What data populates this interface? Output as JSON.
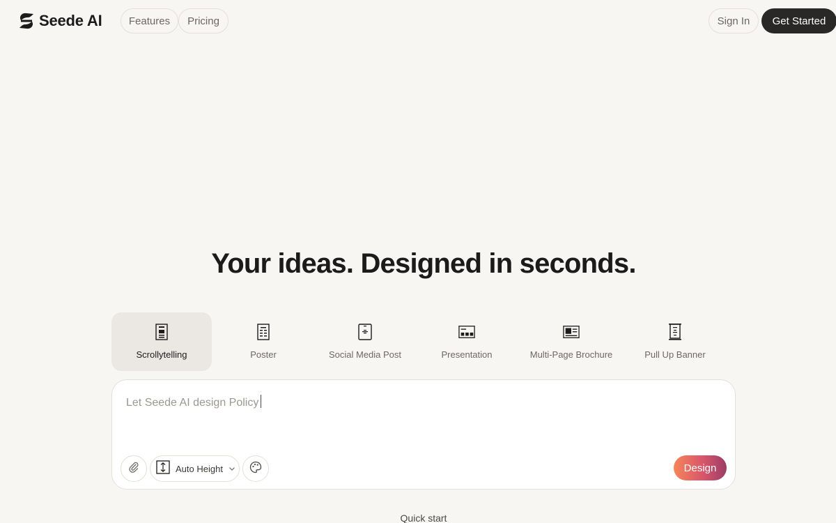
{
  "brand": {
    "name": "Seede AI",
    "icon": "seede-logo-icon"
  },
  "nav": {
    "features": "Features",
    "pricing": "Pricing",
    "sign_in": "Sign In",
    "get_started": "Get Started"
  },
  "hero": {
    "title": "Your ideas. Designed in seconds."
  },
  "types": [
    {
      "label": "Scrollytelling",
      "icon": "scrollytelling-icon",
      "active": true
    },
    {
      "label": "Poster",
      "icon": "poster-icon",
      "active": false
    },
    {
      "label": "Social Media Post",
      "icon": "social-post-icon",
      "active": false
    },
    {
      "label": "Presentation",
      "icon": "presentation-icon",
      "active": false
    },
    {
      "label": "Multi-Page Brochure",
      "icon": "brochure-icon",
      "active": false
    },
    {
      "label": "Pull Up Banner",
      "icon": "banner-icon",
      "active": false
    }
  ],
  "prompt": {
    "placeholder": "Let Seede AI design Policy",
    "height_option": "Auto Height",
    "design_label": "Design"
  },
  "footer": {
    "quick_start": "Quick start"
  },
  "colors": {
    "background": "#f8f6f2",
    "primary_button": "#2a2826",
    "design_gradient_start": "#f5855a",
    "design_gradient_end": "#9a3d66"
  }
}
